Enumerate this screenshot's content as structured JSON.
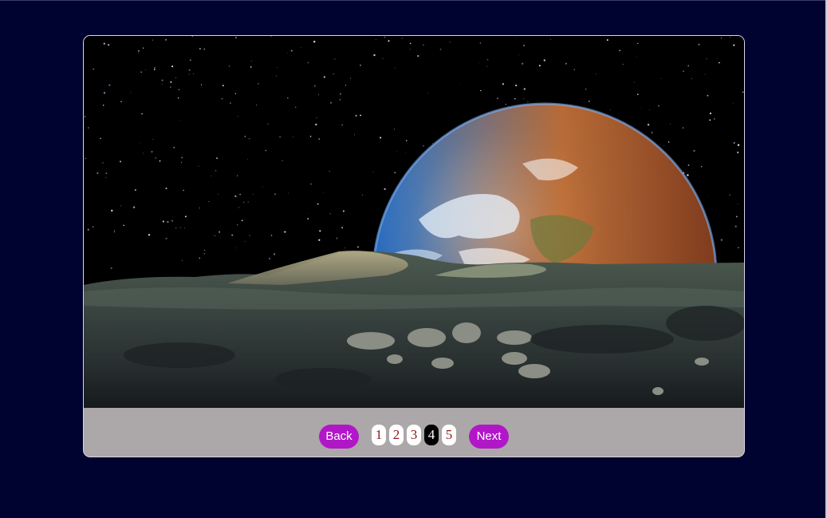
{
  "slideshow": {
    "image_description_icon": "earth-rising-over-moon-photo",
    "back_label": "Back",
    "next_label": "Next",
    "pages": [
      "1",
      "2",
      "3",
      "4",
      "5"
    ],
    "active_page": "4"
  },
  "colors": {
    "page_background": "#000230",
    "control_bar": "#aca7a8",
    "button": "#b117c8",
    "dot_text": "#8b1a1a",
    "active_dot": "#000000"
  }
}
